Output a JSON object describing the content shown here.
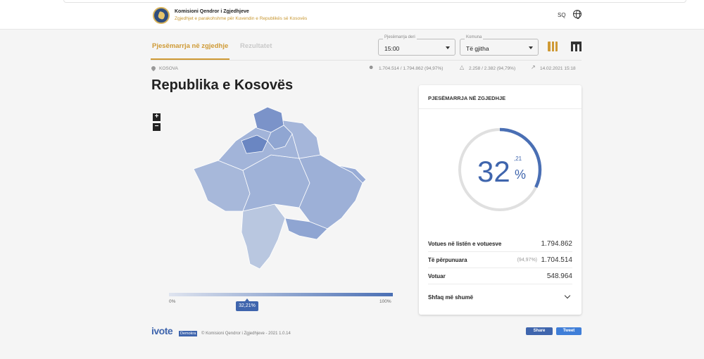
{
  "header": {
    "org_name": "Komisioni Qendror i Zgjedhjeve",
    "org_subtitle": "Zgjedhjet e parakohshme për Kuvendin e Republikës së Kosovës",
    "language": "SQ"
  },
  "tabs": [
    {
      "label": "Pjesëmarrja në zgjedhje",
      "active": true
    },
    {
      "label": "Rezultatet",
      "active": false
    }
  ],
  "filters": {
    "time": {
      "label": "Pjesëmarrja deri",
      "value": "15:00"
    },
    "komuna": {
      "label": "Komuna",
      "value": "Të gjitha"
    }
  },
  "breadcrumb": "KOSOVA",
  "stats": {
    "voters": "1.704.514 / 1.794.862 (94,97%)",
    "stations": "2.258 / 2.382 (94,79%)",
    "updated": "14.02.2021 15:18"
  },
  "region_title": "Republika e Kosovës",
  "map": {
    "legend_min": "0%",
    "legend_max": "100%",
    "marker": "32,21%",
    "marker_fraction": 0.3221
  },
  "card": {
    "title": "PJESËMARRJA NË ZGJEDHJE",
    "turnout_int": "32",
    "turnout_dec": ",21",
    "turnout_sign": "%",
    "turnout_fraction": 0.3221,
    "rows": [
      {
        "label": "Votues në listën e votuesve",
        "note": "",
        "value": "1.794.862"
      },
      {
        "label": "Të përpunuara",
        "note": "(94,97%)",
        "value": "1.704.514"
      },
      {
        "label": "Votuar",
        "note": "",
        "value": "548.964"
      }
    ],
    "show_more": "Shfaq më shumë"
  },
  "footer": {
    "logo": "ivote",
    "badge": "Demokra",
    "copyright": "© Komisioni Qendror i Zgjedhjeve - 2021 1.0.14",
    "share_fb": "Share",
    "share_tw": "Tweet"
  },
  "colors": {
    "accent": "#cf9a35",
    "primary": "#3f65ad"
  }
}
